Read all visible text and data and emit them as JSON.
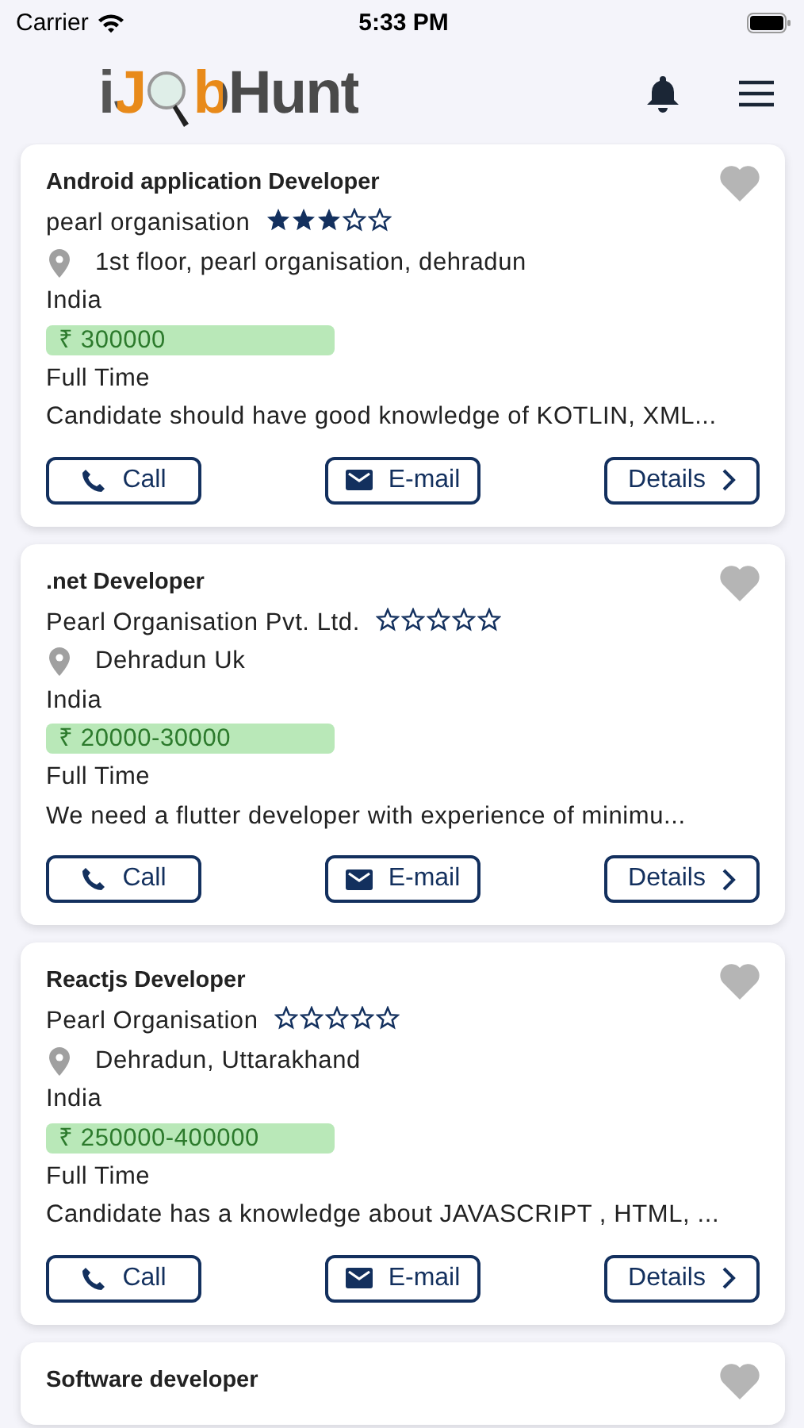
{
  "status_bar": {
    "carrier": "Carrier",
    "time": "5:33 PM"
  },
  "header": {
    "logo_start": "iJ",
    "logo_end": "bHunt"
  },
  "jobs": [
    {
      "title": "Android application Developer",
      "company": "pearl organisation",
      "stars": 3,
      "address": "1st floor, pearl organisation, dehradun",
      "country": "India",
      "currency": "₹",
      "salary": "300000",
      "job_type": "Full Time",
      "description": "Candidate should have good knowledge of KOTLIN, XML...",
      "favorite": false,
      "buttons": [
        {
          "kind": "call",
          "label": "Call"
        },
        {
          "kind": "email",
          "label": "E-mail"
        },
        {
          "kind": "details",
          "label": "Details"
        }
      ]
    },
    {
      "title": ".net Developer",
      "company": "Pearl Organisation Pvt. Ltd.",
      "stars": 0,
      "address": "Dehradun Uk",
      "country": "India",
      "currency": "₹",
      "salary": "20000-30000",
      "job_type": "Full Time",
      "description": "We need a flutter developer with experience of minimu...",
      "favorite": false,
      "buttons": [
        {
          "kind": "call",
          "label": "Call"
        },
        {
          "kind": "email",
          "label": "E-mail"
        },
        {
          "kind": "details",
          "label": "Details"
        }
      ]
    },
    {
      "title": "Reactjs Developer",
      "company": "Pearl Organisation",
      "stars": 0,
      "address": "Dehradun, Uttarakhand",
      "country": "India",
      "currency": "₹",
      "salary": "250000-400000",
      "job_type": "Full Time",
      "description": "Candidate has a knowledge about JAVASCRIPT , HTML, ...",
      "favorite": false,
      "buttons": [
        {
          "kind": "call",
          "label": "Call"
        },
        {
          "kind": "email",
          "label": "E-mail"
        },
        {
          "kind": "details",
          "label": "Details"
        }
      ]
    },
    {
      "title": "Software developer",
      "favorite": false
    }
  ]
}
